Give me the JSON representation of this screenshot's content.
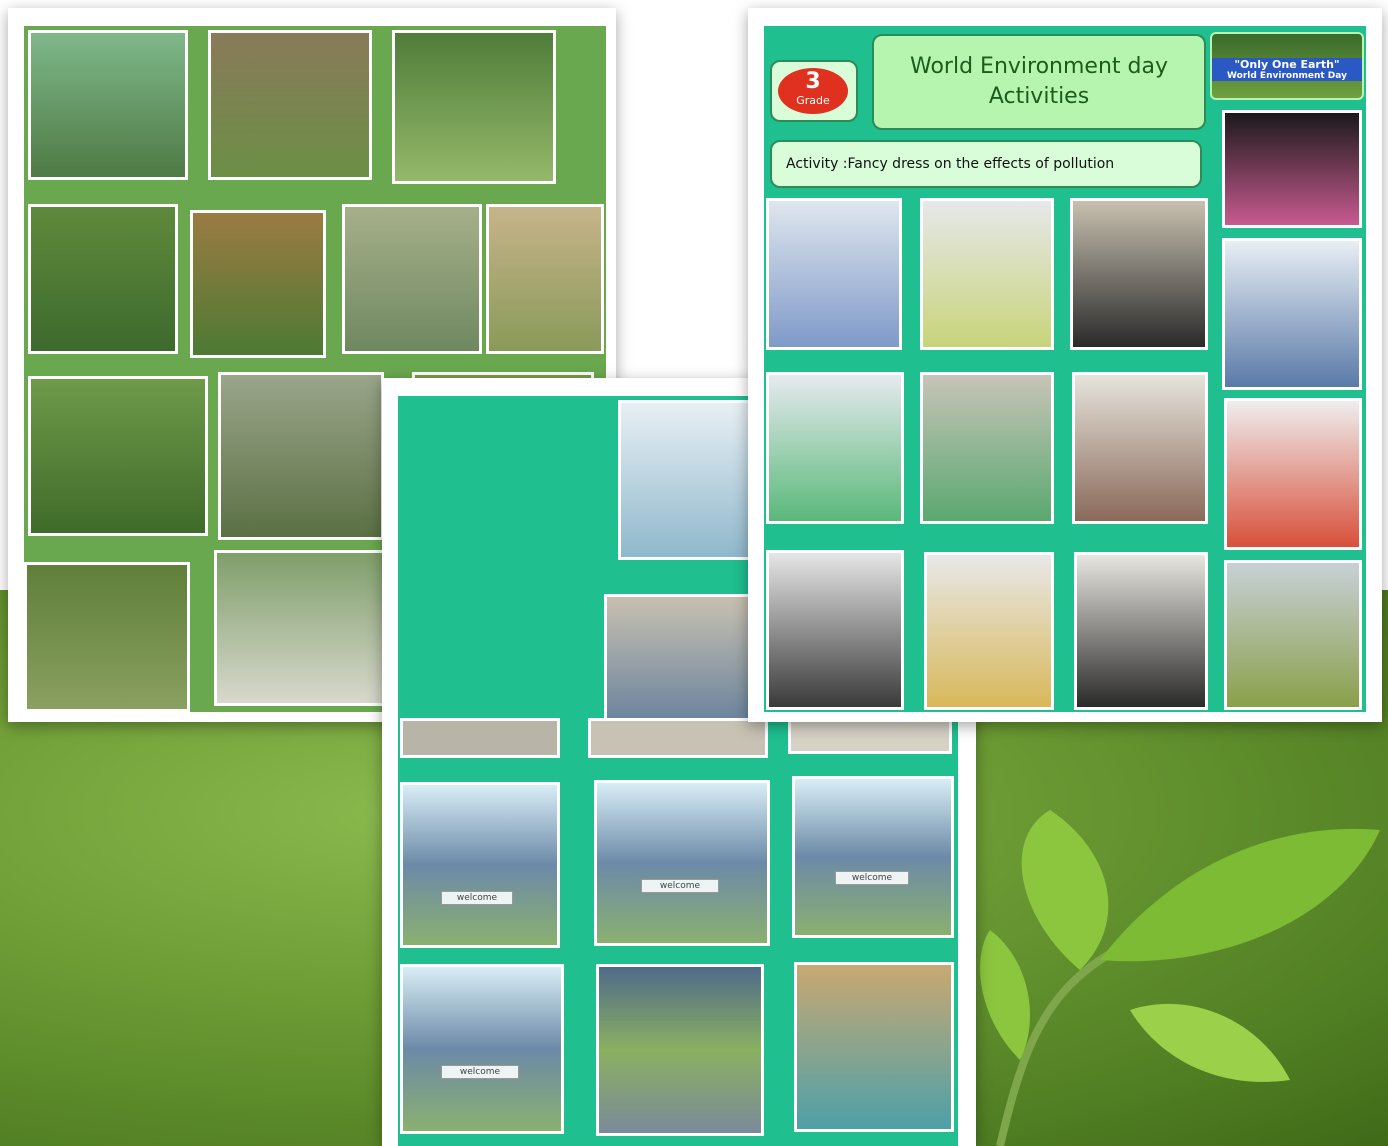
{
  "posters": {
    "right": {
      "grade_number": "3",
      "grade_word": "Grade",
      "title_line1": "World Environment day",
      "title_line2": "Activities",
      "earth_title": "\"Only One Earth\"",
      "earth_subtitle": "World Environment Day",
      "activity": "Activity :Fancy dress  on the effects of pollution"
    },
    "middle": {
      "welcome_sign": "welcome"
    }
  },
  "colors": {
    "left_board": "#6aa84f",
    "teal_board": "#1fbf8f",
    "grade_red": "#e0301e",
    "title_green": "#b6f5b0"
  }
}
